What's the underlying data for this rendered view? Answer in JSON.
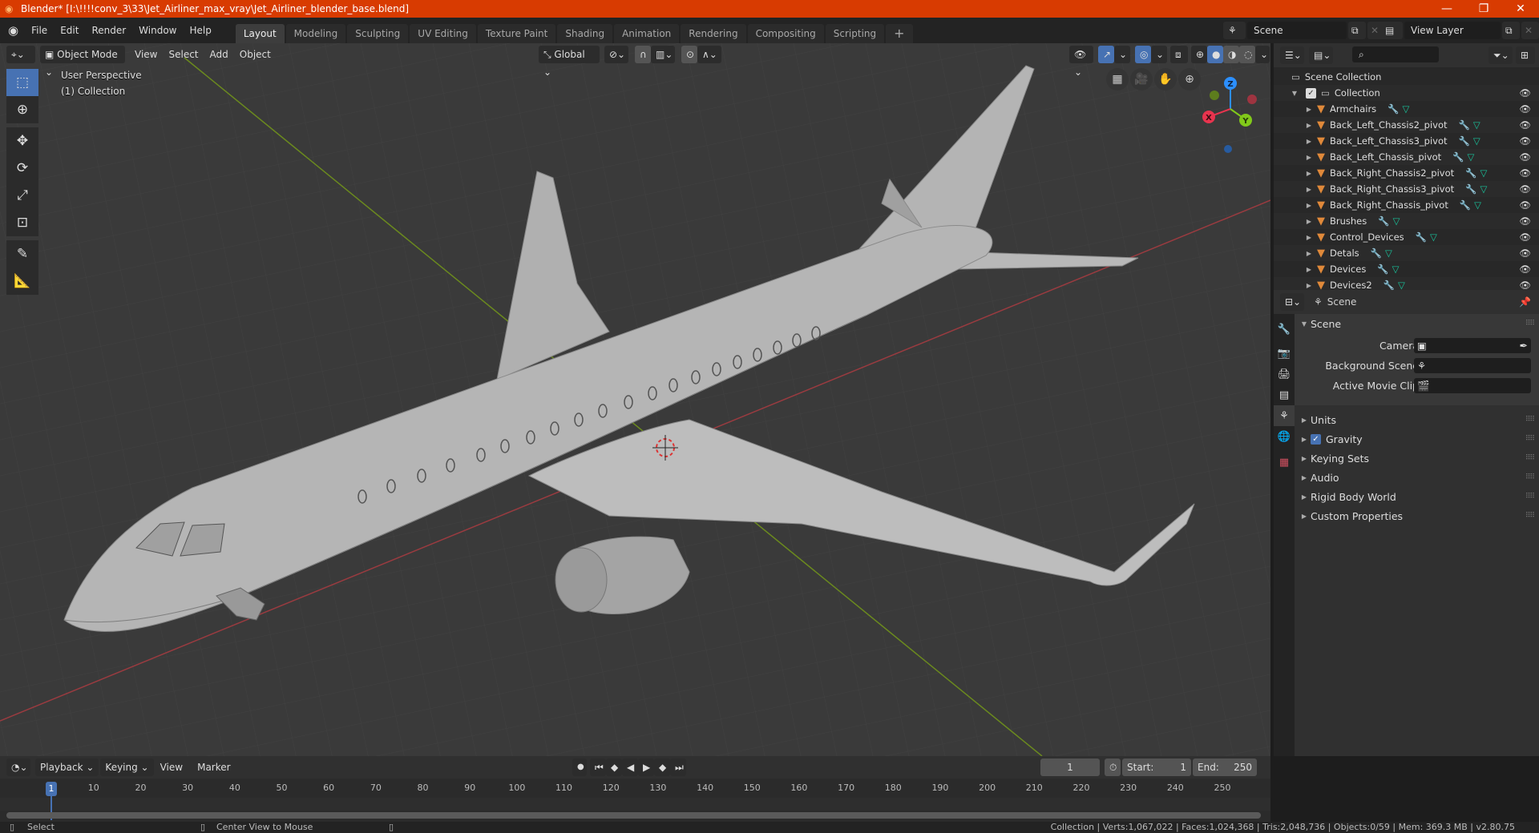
{
  "window": {
    "title": "Blender* [I:\\!!!!conv_3\\33\\Jet_Airliner_max_vray\\Jet_Airliner_blender_base.blend]",
    "controls": {
      "minimize": "—",
      "maximize": "❐",
      "close": "✕"
    }
  },
  "menubar": {
    "items": [
      "File",
      "Edit",
      "Render",
      "Window",
      "Help"
    ],
    "workspaces": [
      "Layout",
      "Modeling",
      "Sculpting",
      "UV Editing",
      "Texture Paint",
      "Shading",
      "Animation",
      "Rendering",
      "Compositing",
      "Scripting"
    ],
    "active_workspace": "Layout",
    "add_workspace": "+",
    "scene": "Scene",
    "view_layer": "View Layer"
  },
  "viewport": {
    "mode": "Object Mode",
    "menus": [
      "View",
      "Select",
      "Add",
      "Object"
    ],
    "orientation": "Global",
    "overlay_title": "User Perspective",
    "overlay_subtitle": "(1) Collection",
    "gizmo_axes": {
      "x": "X",
      "y": "Y",
      "z": "Z"
    },
    "colors": {
      "x": "#e8344e",
      "y": "#81c91a",
      "z": "#2c8fff",
      "active": "#4772b3"
    }
  },
  "outliner": {
    "search_placeholder": "",
    "root": "Scene Collection",
    "collection": "Collection",
    "items": [
      {
        "name": "Armchairs"
      },
      {
        "name": "Back_Left_Chassis2_pivot"
      },
      {
        "name": "Back_Left_Chassis3_pivot"
      },
      {
        "name": "Back_Left_Chassis_pivot"
      },
      {
        "name": "Back_Right_Chassis2_pivot"
      },
      {
        "name": "Back_Right_Chassis3_pivot"
      },
      {
        "name": "Back_Right_Chassis_pivot"
      },
      {
        "name": "Brushes"
      },
      {
        "name": "Control_Devices"
      },
      {
        "name": "Detals"
      },
      {
        "name": "Devices"
      },
      {
        "name": "Devices2"
      }
    ]
  },
  "properties": {
    "context": "Scene",
    "panel_title": "Scene",
    "fields": [
      {
        "label": "Camera",
        "value": ""
      },
      {
        "label": "Background Scene",
        "value": ""
      },
      {
        "label": "Active Movie Clip",
        "value": ""
      }
    ],
    "subpanels": [
      "Units",
      "Gravity",
      "Keying Sets",
      "Audio",
      "Rigid Body World",
      "Custom Properties"
    ],
    "gravity_checked": true
  },
  "timeline": {
    "menus": [
      "Playback",
      "Keying",
      "View",
      "Marker"
    ],
    "current_frame": "1",
    "start_label": "Start:",
    "start": "1",
    "end_label": "End:",
    "end": "250",
    "ticks": [
      "10",
      "20",
      "30",
      "40",
      "50",
      "60",
      "70",
      "80",
      "90",
      "100",
      "110",
      "120",
      "130",
      "140",
      "150",
      "160",
      "170",
      "180",
      "190",
      "200",
      "210",
      "220",
      "230",
      "240",
      "250"
    ]
  },
  "statusbar": {
    "left_action": "Select",
    "middle_action": "Center View to Mouse",
    "stats": "Collection | Verts:1,067,022 | Faces:1,024,368 | Tris:2,048,736 | Objects:0/59 | Mem: 369.3 MB | v2.80.75"
  }
}
